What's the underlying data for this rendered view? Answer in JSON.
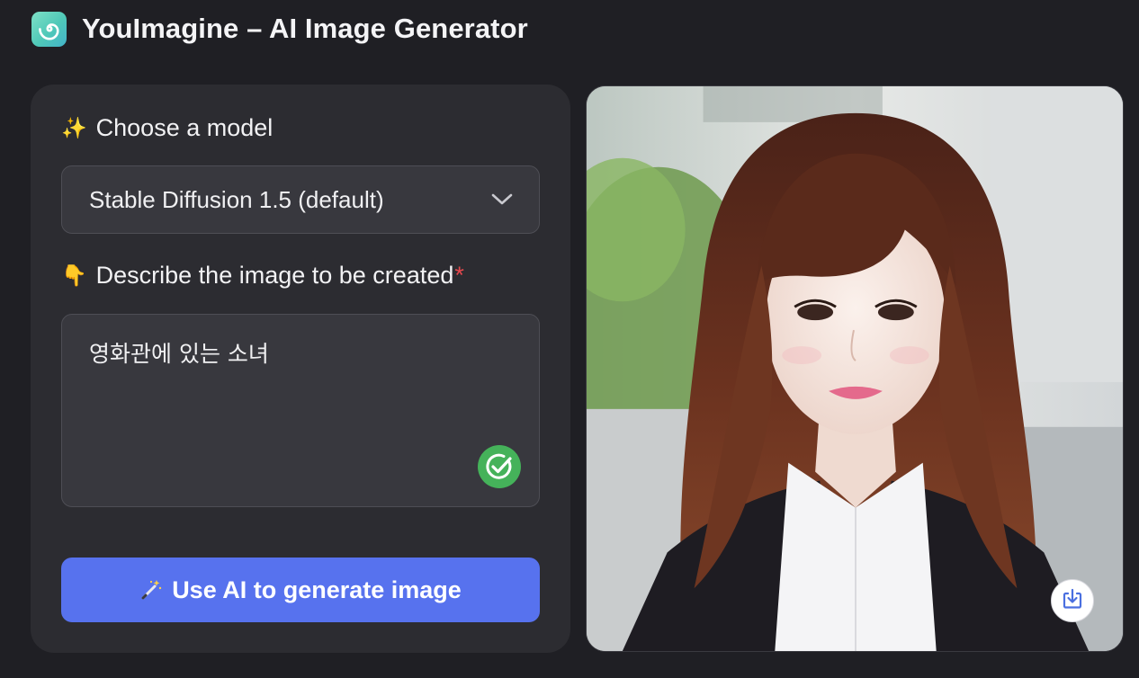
{
  "header": {
    "title": "YouImagine – AI Image Generator",
    "logo_icon": "spiral-icon",
    "logo_color": "#5fd2bf"
  },
  "form": {
    "model_label_emoji": "✨",
    "model_label": "Choose a model",
    "model_selected": "Stable Diffusion 1.5 (default)",
    "prompt_label_emoji": "👇",
    "prompt_label": "Describe the image to be created",
    "required_marker": "*",
    "prompt_value": "영화관에 있는 소녀",
    "prompt_status_icon": "check-circle-icon",
    "generate_label": "Use AI to generate image",
    "generate_icon": "magic-wand-icon"
  },
  "preview": {
    "image_subject": "generated-portrait-image",
    "download_icon": "download-icon"
  },
  "colors": {
    "background": "#1f1f24",
    "panel": "#2c2c31",
    "accent": "#5772ee",
    "success": "#45b25a",
    "required": "#e5484d"
  }
}
